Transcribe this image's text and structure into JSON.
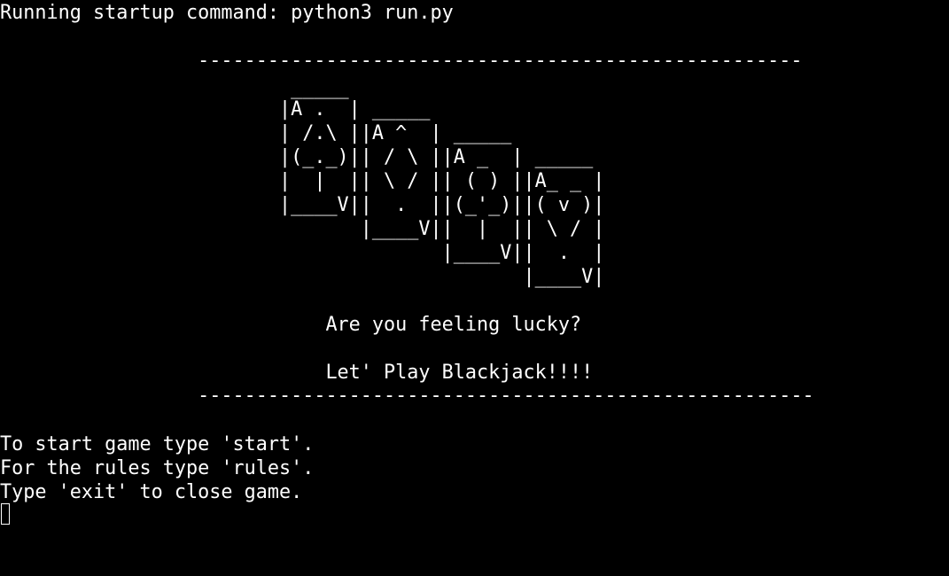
{
  "terminal": {
    "lines": [
      "Running startup command: python3 run.py",
      "",
      "                 ----------------------------------------------------",
      "",
      "                         _____",
      "                        |A .  | _____",
      "                        | /.\\ ||A ^  | _____",
      "                        |(_._)|| / \\ ||A _  | _____",
      "                        |  |  || \\ / || ( ) ||A_ _ |",
      "                        |____V||  .  ||(_'_)||( v )|",
      "                               |____V||  |  || \\ / |",
      "                                      |____V||  .  |",
      "                                             |____V|",
      "",
      "                            Are you feeling lucky?",
      "",
      "                            Let' Play Blackjack!!!!",
      "                 -----------------------------------------------------",
      "",
      "To start game type 'start'.",
      "For the rules type 'rules'.",
      "Type 'exit' to close game."
    ]
  },
  "colors": {
    "background": "#000000",
    "foreground": "#ffffff"
  }
}
